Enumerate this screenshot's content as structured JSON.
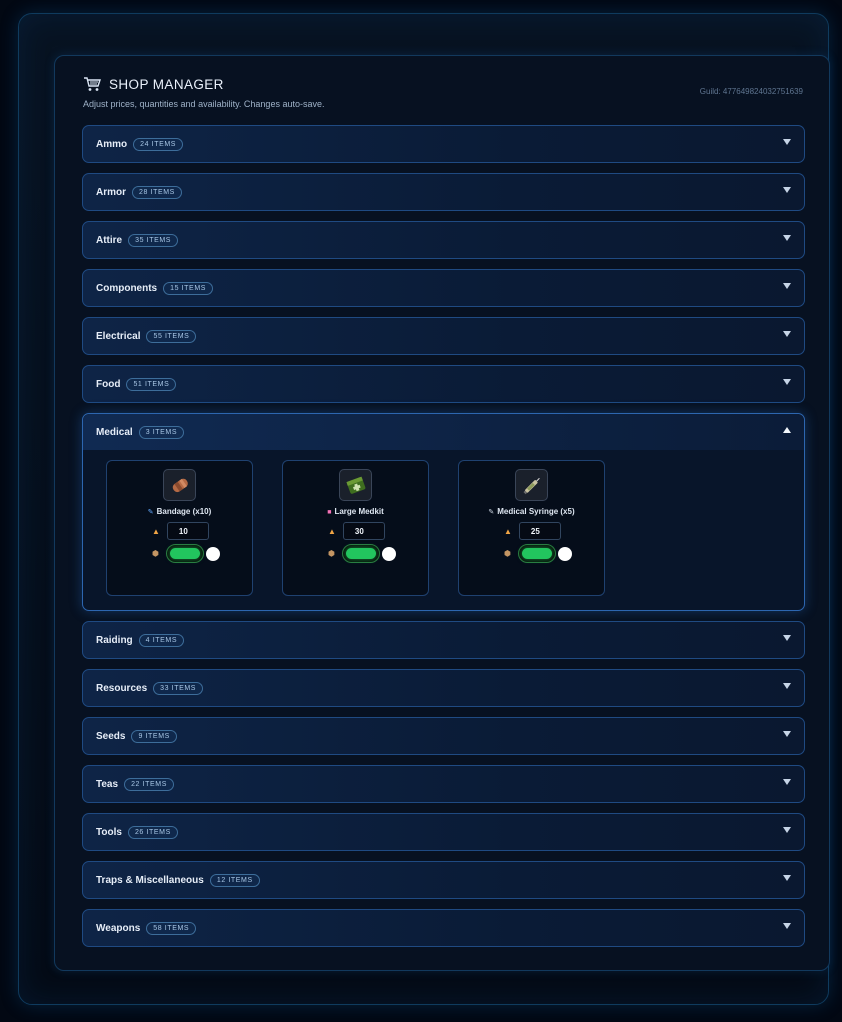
{
  "header": {
    "title": "SHOP MANAGER",
    "subtitle": "Adjust prices, quantities and availability. Changes auto-save.",
    "guild": "Guild: 477649824032751639"
  },
  "categories": [
    {
      "name": "Ammo",
      "badge": "24 ITEMS"
    },
    {
      "name": "Armor",
      "badge": "28 ITEMS"
    },
    {
      "name": "Attire",
      "badge": "35 ITEMS"
    },
    {
      "name": "Components",
      "badge": "15 ITEMS"
    },
    {
      "name": "Electrical",
      "badge": "55 ITEMS"
    },
    {
      "name": "Food",
      "badge": "51 ITEMS"
    },
    {
      "name": "Medical",
      "badge": "3 ITEMS",
      "expanded": true,
      "items": [
        {
          "name": "Bandage (x10)",
          "icon": "bandage-icon",
          "price": "10",
          "enabled": true
        },
        {
          "name": "Large Medkit",
          "icon": "medkit-icon",
          "price": "30",
          "enabled": true
        },
        {
          "name": "Medical Syringe (x5)",
          "icon": "syringe-icon",
          "price": "25",
          "enabled": true
        }
      ]
    },
    {
      "name": "Raiding",
      "badge": "4 ITEMS"
    },
    {
      "name": "Resources",
      "badge": "33 ITEMS"
    },
    {
      "name": "Seeds",
      "badge": "9 ITEMS"
    },
    {
      "name": "Teas",
      "badge": "22 ITEMS"
    },
    {
      "name": "Tools",
      "badge": "26 ITEMS"
    },
    {
      "name": "Traps & Miscellaneous",
      "badge": "12 ITEMS"
    },
    {
      "name": "Weapons",
      "badge": "58 ITEMS"
    }
  ],
  "colors": {
    "accent": "#2d66b0",
    "toggle_on": "#22c55e",
    "price_icon": "#f0a445"
  }
}
